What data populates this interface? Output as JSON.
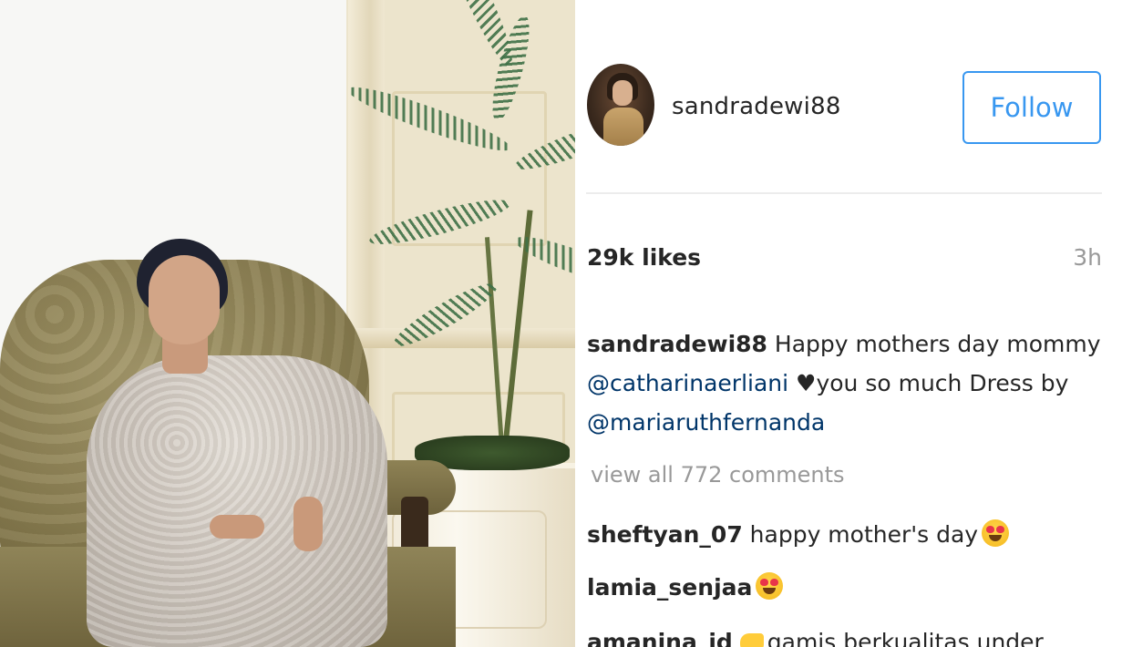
{
  "post": {
    "username": "sandradewi88",
    "follow_label": "Follow",
    "likes": "29k likes",
    "time_ago": "3h",
    "caption": {
      "username": "sandradewi88",
      "text_part1": " Happy mothers day mommy ",
      "mention1": "@catharinaerliani",
      "heart": " ♥",
      "text_part2": "you so much Dress by ",
      "mention2": "@mariaruthfernanda"
    },
    "view_comments": "view all 772 comments",
    "comments": [
      {
        "user": "sheftyan_07",
        "text": " happy mother's day",
        "emoji": "heart-eyes-emoji"
      },
      {
        "user": "lamia_senjaa",
        "text": "",
        "emoji": "heart-eyes-emoji"
      },
      {
        "user": "amanina_id",
        "text": "gamis berkualitas under",
        "emoji": "pointing-hand-emoji"
      }
    ]
  },
  "colors": {
    "accent_blue": "#3897f0",
    "mention_blue": "#003569",
    "muted_gray": "#999999",
    "text": "#262626"
  }
}
